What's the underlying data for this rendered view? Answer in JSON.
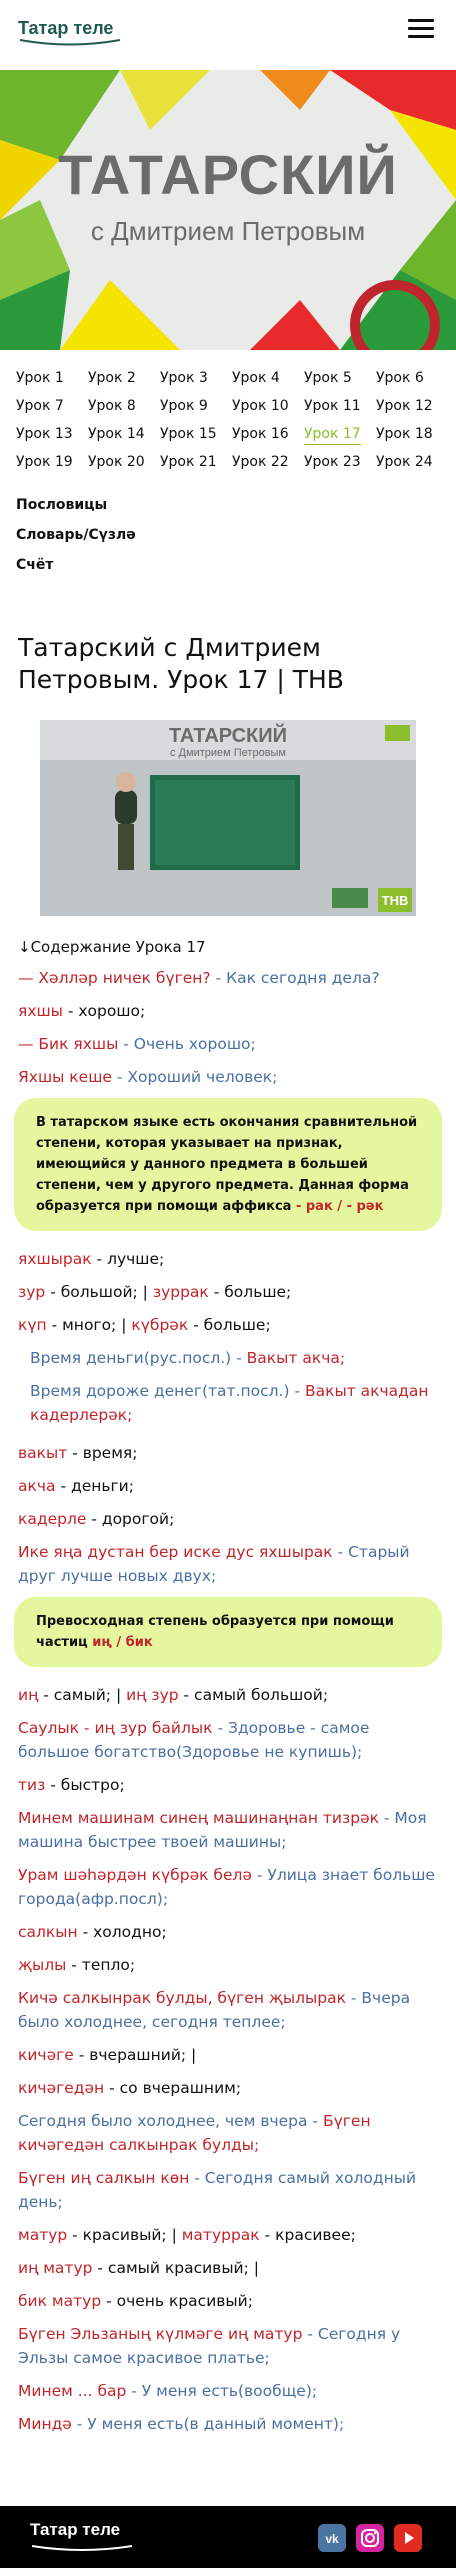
{
  "header": {
    "logo": "Татар теле"
  },
  "hero": {
    "title": "ТАТАРСКИЙ",
    "subtitle": "с Дмитрием Петровым"
  },
  "lessons": [
    "Урок 1",
    "Урок 2",
    "Урок 3",
    "Урок 4",
    "Урок 5",
    "Урок 6",
    "Урок 7",
    "Урок 8",
    "Урок 9",
    "Урок 10",
    "Урок 11",
    "Урок 12",
    "Урок 13",
    "Урок 14",
    "Урок 15",
    "Урок 16",
    "Урок 17",
    "Урок 18",
    "Урок 19",
    "Урок 20",
    "Урок 21",
    "Урок 22",
    "Урок 23",
    "Урок 24"
  ],
  "active_lesson": "Урок 17",
  "menu": {
    "proverbs": "Пословицы",
    "dictionary": "Словарь/Сүзлә",
    "counting": "Счёт"
  },
  "page_title": "Татарский с Дмитрием Петровым. Урок 17 | ТНВ",
  "video": {
    "title": "ТАТАРСКИЙ",
    "subtitle": "с Дмитрием Петровым",
    "badge": "ТНВ"
  },
  "toc": "Содержание Урока 17",
  "c": {
    "l1a": "— Хәлләр ничек бүген?",
    "l1b": " - Как сегодня дела?",
    "l2a": "яхшы",
    "l2b": " - хорошо;",
    "l3a": "— Бик яхшы",
    "l3b": " - Очень хорошо;",
    "l4a": "Яхшы кеше",
    "l4b": " - Хороший человек;",
    "box1a": "В татарском языке есть окончания сравнительной степени, которая указывает на признак, имеющийся у данного предмета в большей степени, чем у другого предмета. Данная форма образуется при помощи аффикса ",
    "box1b": "- рак / - рәк",
    "l5a": "яхшырак",
    "l5b": " - лучше;",
    "l6a": "зур",
    "l6b": " - большой; | ",
    "l6c": "зуррак",
    "l6d": " - больше;",
    "l7a": "күп",
    "l7b": " - много; | ",
    "l7c": "күбрәк",
    "l7d": " - больше;",
    "l8a": "Время деньги(рус.посл.) - ",
    "l8b": "Вакыт акча;",
    "l9a": "Время дороже денег(тат.посл.) - ",
    "l9b": "Вакыт акчадан кадерлерәк;",
    "l10a": "вакыт",
    "l10b": " - время;",
    "l11a": "акча",
    "l11b": " - деньги;",
    "l12a": "кадерле",
    "l12b": " - дорогой;",
    "l13a": "Ике яңа дустан бер иске дус яхшырак",
    "l13b": " - Старый друг лучше новых двух;",
    "box2a": "Превосходная степень образуется при помощи частиц ",
    "box2b": "иң / бик",
    "l14a": "иң",
    "l14b": " - самый; | ",
    "l14c": "иң зур",
    "l14d": " - самый большой;",
    "l15a": "Саулык - иң зур байлык",
    "l15b": " - Здоровье - самое большое богатство(Здоровье не купишь);",
    "l16a": "тиз",
    "l16b": " - быстро;",
    "l17a": "Минем машинам синең машинаңнан тизрәк",
    "l17b": " - Моя машина быстрее твоей машины;",
    "l18a": "Урам шәһәрдән күбрәк белә",
    "l18b": " - Улица знает больше города(афр.посл);",
    "l19a": "салкын",
    "l19b": " - холодно;",
    "l20a": "җылы",
    "l20b": " - тепло;",
    "l21a": "Кичә салкынрак булды, бүген җылырак",
    "l21b": " - Вчера было холоднее, сегодня теплее;",
    "l22a": "кичәге",
    "l22b": " - вчерашний; |",
    "l23a": "кичәгедән",
    "l23b": " - со вчерашним;",
    "l24a": "Сегодня было холоднее, чем вчера - ",
    "l24b": "Бүген кичәгедән салкынрак булды;",
    "l25a": "Бүген иң салкын көн",
    "l25b": " - Сегодня самый холодный день;",
    "l26a": "матур",
    "l26b": " - красивый; | ",
    "l26c": "матуррак",
    "l26d": " - красивее;",
    "l27a": "иң матур",
    "l27b": " - самый красивый; |",
    "l28a": "бик матур",
    "l28b": " - очень красивый;",
    "l29a": "Бүген Эльзаның күлмәге иң матур",
    "l29b": " - Сегодня у Эльзы самое красивое платье;",
    "l30a": "Минем ... бар",
    "l30b": " - У меня есть(вообще);",
    "l31a": "Миндә",
    "l31b": " - У меня есть(в данный момент);"
  },
  "footer": {
    "logo": "Татар теле"
  },
  "colors": {
    "accent": "#8bbd2c",
    "red": "#c0252b",
    "blue": "#4b6fa2",
    "box": "#e4f79e"
  }
}
